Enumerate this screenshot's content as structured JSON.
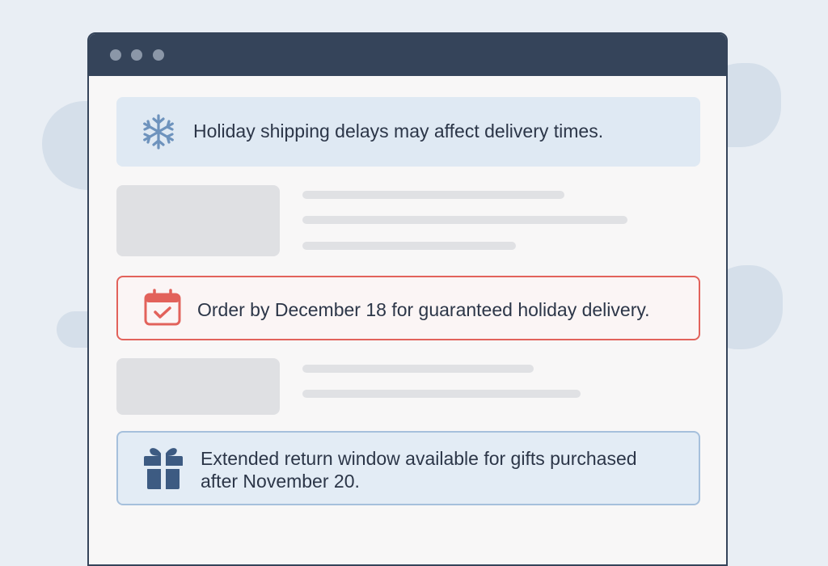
{
  "window": {
    "controls": [
      "close",
      "minimize",
      "maximize"
    ]
  },
  "notices": {
    "info": {
      "icon": "snowflake-icon",
      "text": "Holiday shipping delays may affect delivery times."
    },
    "deadline": {
      "icon": "calendar-check-icon",
      "text": "Order by December 18 for guaranteed holiday delivery."
    },
    "returns": {
      "icon": "gift-icon",
      "text": "Extended return window available for gifts purchased after November 20."
    }
  },
  "colors": {
    "titlebar": "#35445a",
    "info_bg": "#dfe9f3",
    "deadline_border": "#e2625b",
    "returns_border": "#a6c0dc",
    "text": "#2c3648"
  }
}
